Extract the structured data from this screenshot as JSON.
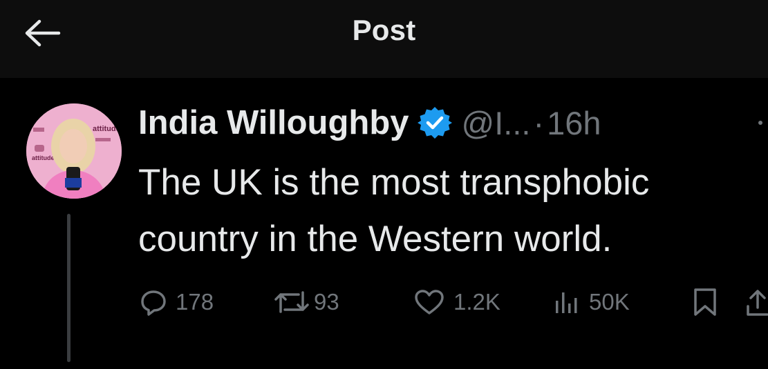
{
  "header": {
    "title": "Post",
    "back_icon": "arrow-left-icon"
  },
  "post": {
    "author": {
      "display_name": "India Willoughby",
      "handle": "@I...",
      "verified_icon": "verified-badge-icon",
      "verified_color": "#1d9bf0",
      "avatar_text": "attitude"
    },
    "dot": "·",
    "time": "16h",
    "more_icon": "more-dots-icon",
    "text_lines": [
      "The UK is the most transphobic",
      "country in the Western world."
    ],
    "actions": {
      "replies": {
        "icon": "reply-icon",
        "count": "178"
      },
      "reposts": {
        "icon": "repost-icon",
        "count": "93"
      },
      "likes": {
        "icon": "heart-icon",
        "count": "1.2K"
      },
      "views": {
        "icon": "views-icon",
        "count": "50K"
      },
      "bookmark": {
        "icon": "bookmark-icon"
      },
      "share": {
        "icon": "share-icon"
      }
    }
  },
  "colors": {
    "background": "#000000",
    "topbar": "#0d0d0d",
    "text_primary": "#e7e9ea",
    "text_secondary": "#71767b",
    "thread_line": "#3a3d40"
  }
}
